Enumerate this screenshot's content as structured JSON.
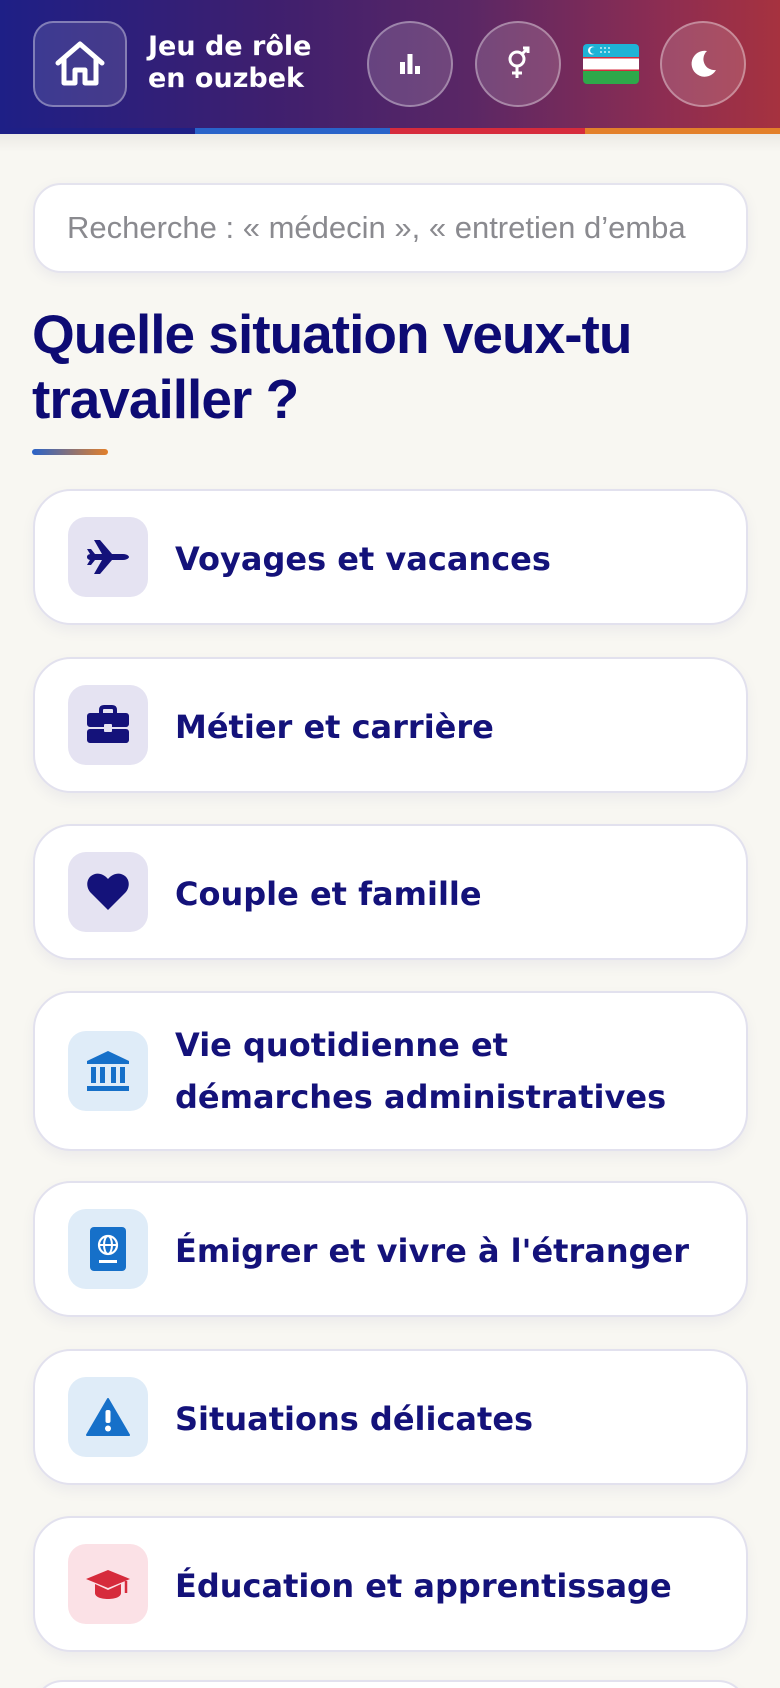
{
  "header": {
    "title_line1": "Jeu de rôle",
    "title_line2": "en ouzbek",
    "home_icon": "home-icon",
    "buttons": [
      "stats-icon",
      "gender-icon",
      "moon-icon"
    ],
    "flag": "uzbekistan-flag",
    "stripe_colors": [
      "#1e1f86",
      "#2a63c9",
      "#d62b3c",
      "#e3802a"
    ]
  },
  "search": {
    "placeholder": "Recherche : « médecin », « entretien d’embauche »"
  },
  "main": {
    "title": "Quelle situation veux-tu travailler ?",
    "categories": [
      {
        "label": "Voyages et vacances",
        "icon": "airplane-icon",
        "icon_color": "#14127a"
      },
      {
        "label": "Métier et carrière",
        "icon": "briefcase-icon",
        "icon_color": "#14127a"
      },
      {
        "label": "Couple et famille",
        "icon": "heart-icon",
        "icon_color": "#14127a"
      },
      {
        "label": "Vie quotidienne et démarches administratives",
        "icon": "bank-icon",
        "icon_color": "#1670c9"
      },
      {
        "label": "Émigrer et vivre à l'étranger",
        "icon": "passport-icon",
        "icon_color": "#1670c9"
      },
      {
        "label": "Situations délicates",
        "icon": "warning-icon",
        "icon_color": "#1670c9"
      },
      {
        "label": "Éducation et apprentissage",
        "icon": "graduation-cap-icon",
        "icon_color": "#d62b3c"
      }
    ]
  }
}
